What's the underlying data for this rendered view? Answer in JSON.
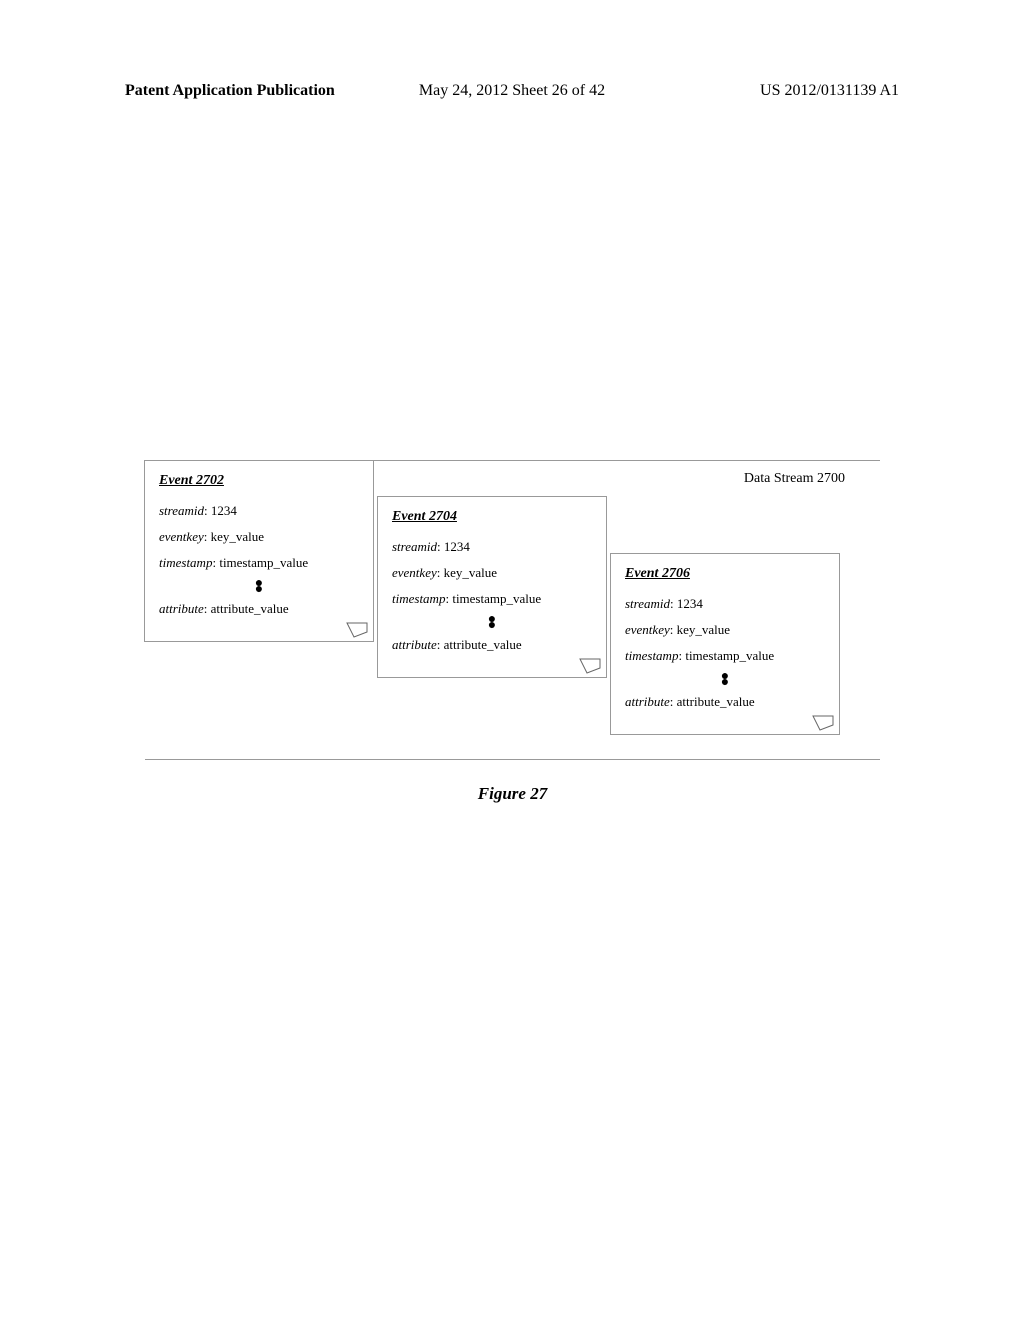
{
  "header": {
    "left": "Patent Application Publication",
    "center": "May 24, 2012  Sheet 26 of 42",
    "right": "US 2012/0131139 A1"
  },
  "diagram": {
    "stream_label": "Data Stream 2700",
    "events": [
      {
        "title": "Event 2702",
        "streamid_label": "streamid",
        "streamid_value": "1234",
        "eventkey_label": "eventkey",
        "eventkey_value": "key_value",
        "timestamp_label": "timestamp",
        "timestamp_value": "timestamp_value",
        "attribute_label": "attribute",
        "attribute_value": "attribute_value"
      },
      {
        "title": "Event 2704",
        "streamid_label": "streamid",
        "streamid_value": "1234",
        "eventkey_label": "eventkey",
        "eventkey_value": "key_value",
        "timestamp_label": "timestamp",
        "timestamp_value": "timestamp_value",
        "attribute_label": "attribute",
        "attribute_value": "attribute_value"
      },
      {
        "title": "Event 2706",
        "streamid_label": "streamid",
        "streamid_value": "1234",
        "eventkey_label": "eventkey",
        "eventkey_value": "key_value",
        "timestamp_label": "timestamp",
        "timestamp_value": "timestamp_value",
        "attribute_label": "attribute",
        "attribute_value": "attribute_value"
      }
    ]
  },
  "figure_caption": "Figure 27"
}
